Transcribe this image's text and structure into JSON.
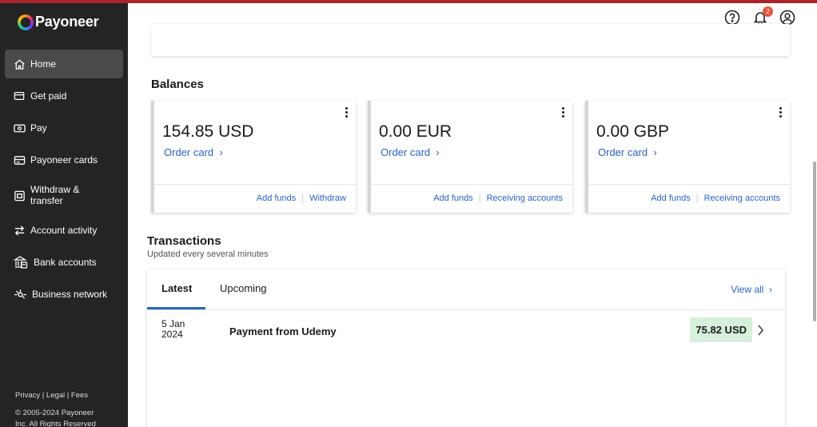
{
  "brand": {
    "name": "Payoneer"
  },
  "sidebar": {
    "items": [
      {
        "label": "Home",
        "icon": "home-icon"
      },
      {
        "label": "Get paid",
        "icon": "card-icon"
      },
      {
        "label": "Pay",
        "icon": "money-icon"
      },
      {
        "label": "Payoneer cards",
        "icon": "payment-card-icon"
      },
      {
        "label": "Withdraw & transfer",
        "icon": "withdraw-icon"
      },
      {
        "label": "Account activity",
        "icon": "arrows-icon"
      },
      {
        "label": "Bank accounts",
        "icon": "bank-icon"
      },
      {
        "label": "Business network",
        "icon": "network-icon"
      }
    ],
    "active": "Home",
    "footer": {
      "privacy": "Privacy",
      "legal": "Legal",
      "fees": "Fees",
      "sep": "|",
      "copyright_line1": "© 2005-2024 Payoneer",
      "copyright_line2": "Inc. All Rights Reserved"
    }
  },
  "header": {
    "help_icon": "help-icon",
    "notifications": {
      "icon": "bell-icon",
      "count": "2"
    },
    "profile_icon": "user-icon"
  },
  "balances": {
    "title": "Balances",
    "cards": [
      {
        "amount": "154.85 USD",
        "order_card": "Order card",
        "actions": [
          "Add funds",
          "Withdraw"
        ]
      },
      {
        "amount": "0.00 EUR",
        "order_card": "Order card",
        "actions": [
          "Add funds",
          "Receiving accounts"
        ]
      },
      {
        "amount": "0.00 GBP",
        "order_card": "Order card",
        "actions": [
          "Add funds",
          "Receiving accounts"
        ]
      }
    ]
  },
  "transactions": {
    "title": "Transactions",
    "subtitle": "Updated every several minutes",
    "tabs": [
      "Latest",
      "Upcoming"
    ],
    "active_tab": "Latest",
    "view_all": "View all",
    "rows": [
      {
        "date_day": "5 Jan",
        "date_year": "2024",
        "description": "Payment from Udemy",
        "amount": "75.82 USD"
      }
    ]
  },
  "colors": {
    "sidebar_bg": "#242424",
    "accent_bar": "#a8262b",
    "link": "#2a63c4",
    "amount_badge": "#d6f0dc",
    "notification_badge": "#e8553e"
  }
}
